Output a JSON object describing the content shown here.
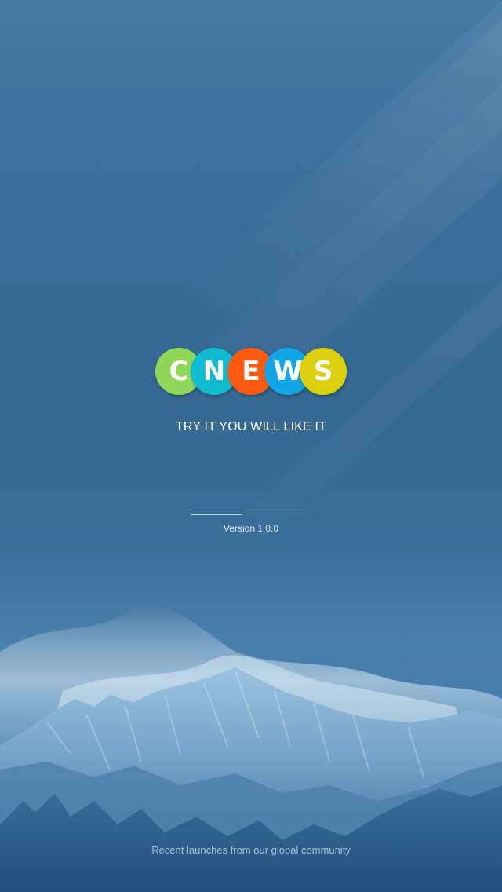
{
  "splash": {
    "logo": {
      "letters": [
        {
          "char": "C",
          "color": "#8fd85a",
          "icon": "logo-letter-c-circle"
        },
        {
          "char": "N",
          "color": "#12bcd0",
          "icon": "logo-letter-n-circle"
        },
        {
          "char": "E",
          "color": "#ff5a0f",
          "icon": "logo-letter-e-circle"
        },
        {
          "char": "W",
          "color": "#12a6e6",
          "icon": "logo-letter-w-circle"
        },
        {
          "char": "S",
          "color": "#dcd00e",
          "icon": "logo-letter-s-circle"
        }
      ]
    },
    "tagline": "TRY IT YOU WILL LIKE IT",
    "loading": {
      "progress_percent": 42,
      "track_color": "#8fd2e6",
      "fill_color": "#a9e6f2"
    },
    "version_text": "Version 1.0.0",
    "footer_text": "Recent launches from our global community"
  },
  "theme": {
    "background": "#3a6c98",
    "accent_text": "#ffffff"
  }
}
